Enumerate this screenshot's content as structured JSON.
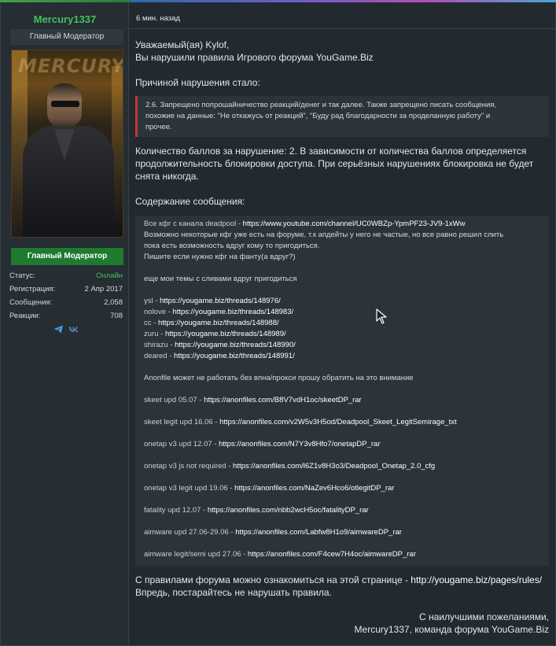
{
  "sidebar": {
    "username": "Mercury1337",
    "user_title": "Главный Модератор",
    "role_badge": "Главный Модератор",
    "stats": [
      {
        "label": "Статус:",
        "value": "Онлайн"
      },
      {
        "label": "Регистрация:",
        "value": "2 Апр 2017"
      },
      {
        "label": "Сообщения:",
        "value": "2,058"
      },
      {
        "label": "Реакции:",
        "value": "708"
      }
    ],
    "avatar_text": "MERCURY"
  },
  "post": {
    "time": "6 мин. назад",
    "greeting": "Уважаемый(ая) Kylof,",
    "violation": "Вы нарушили правила Игрового форума YouGame.Biz",
    "reason_heading": "Причиной нарушения стало:",
    "rule_lines": [
      "2.6. Запрещено попрошайничество реакций/денег и так далее. Также запрещено писать сообщения,",
      "похожие на данные: \"Не откажусь от реакций\", \"Буду рад благодарности за проделанную работу\" и",
      "прочее."
    ],
    "points_lines": [
      "Количество баллов за нарушение: 2. В зависимости от количества баллов определяется",
      "продолжительность блокировки доступа. При серьёзных нарушениях блокировка не будет",
      "снята никогда."
    ],
    "content_heading": "Содержание сообщения:",
    "content": {
      "channel_label": "Все кфг с канала deadpool - ",
      "channel_link": "https://www.youtube.com/channel/UC0WBZp-YpmPF23-JV9-1xWw",
      "note_lines": [
        "Возможно некоторые кфг уже есть на форуме, т.к апдейты у него не частые, но все равно решил слить",
        "пока есть возможность вдруг кому то пригодиться.",
        "Пишите если нужно кфг на фанту(а вдруг?)"
      ],
      "other_themes": "еще мои темы с сливами вдруг пригодиться",
      "threads": [
        {
          "label": "ysl - ",
          "link": "https://yougame.biz/threads/148976/"
        },
        {
          "label": "nolove - ",
          "link": "https://yougame.biz/threads/148983/"
        },
        {
          "label": "cc - ",
          "link": "https://yougame.biz/threads/148988/"
        },
        {
          "label": "zuru - ",
          "link": "https://yougame.biz/threads/148989/"
        },
        {
          "label": "shirazu - ",
          "link": "https://yougame.biz/threads/148990/"
        },
        {
          "label": "deared - ",
          "link": "https://yougame.biz/threads/148991/"
        }
      ],
      "anonfile_note": "Anonfile может не работать без впна/прокси прошу обратить на это внимание",
      "configs": [
        {
          "label": "skeet upd 05.07 - ",
          "link": "https://anonfiles.com/B8V7vdH1oc/skeetDP_rar"
        },
        {
          "label": "skeet legit upd 16.06 - ",
          "link": "https://anonfiles.com/v2W5v3H5od/Deadpool_Skeet_LegitSemirage_txt"
        },
        {
          "label": "onetap v3 upd 12.07 - ",
          "link": "https://anonfiles.com/N7Y3v8Hfo7/onetapDP_rar"
        },
        {
          "label": "onetap v3 js not required - ",
          "link": "https://anonfiles.com/l6Z1v8H3o3/Deadpool_Onetap_2.0_cfg"
        },
        {
          "label": "onetap v3 legit upd 19.06 - ",
          "link": "https://anonfiles.com/NaZev6Hco6/otlegitDP_rar"
        },
        {
          "label": "fatality upd 12.07 - ",
          "link": "https://anonfiles.com/nbb2wcH5oc/fatalityDP_rar"
        },
        {
          "label": "aimware upd 27.06-29.06 - ",
          "link": "https://anonfiles.com/Labfw8H1o9/aimwareDP_rar"
        },
        {
          "label": "aimware legit/semi upd 27.06 - ",
          "link": "https://anonfiles.com/F4cew7H4oc/aimwareDP_rar"
        }
      ]
    },
    "rules_text": "С правилами форума можно ознакомиться на этой странице - ",
    "rules_link": "http://yougame.biz/pages/rules/",
    "rules_after": "Впредь, постарайтесь не нарушать правила.",
    "signature_line1": "С наилучшими пожеланиями,",
    "signature_line2": "Mercury1337, команда форума YouGame.Biz"
  },
  "colors": {
    "accent_green": "#3ec25b",
    "badge_green": "#1d7a2f",
    "quote_red": "#c0392b"
  },
  "icons": [
    "telegram-icon",
    "vk-icon",
    "mouse-cursor-icon"
  ]
}
